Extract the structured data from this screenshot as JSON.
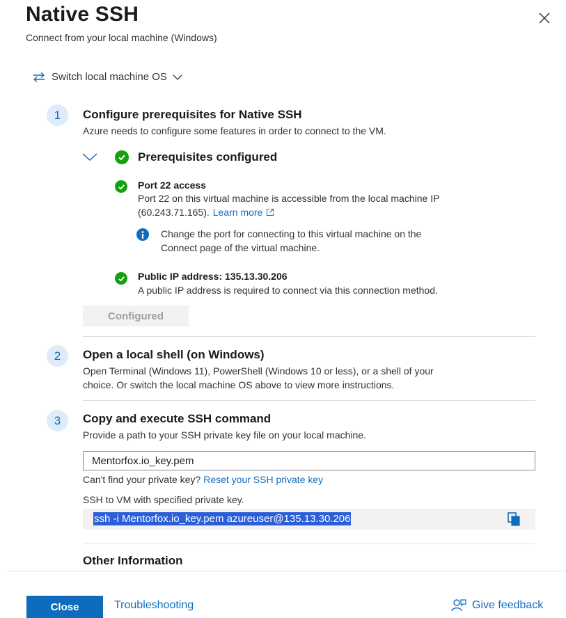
{
  "header": {
    "title": "Native SSH",
    "subtitle": "Connect from your local machine (Windows)"
  },
  "switch_os": {
    "label": "Switch local machine OS"
  },
  "step1": {
    "number": "1",
    "title": "Configure prerequisites for Native SSH",
    "description": "Azure needs to configure some features in order to connect to the VM.",
    "prereq_title": "Prerequisites configured",
    "port": {
      "title": "Port 22 access",
      "line1": "Port 22 on this virtual machine is accessible from the local machine IP",
      "line2": "(60.243.71.165).",
      "learn_more": "Learn more",
      "info_line1": "Change the port for connecting to this virtual machine on the",
      "info_line2": "Connect page of the virtual machine."
    },
    "public_ip": {
      "title": "Public IP address: 135.13.30.206",
      "description": "A public IP address is required to connect via this connection method."
    },
    "configured_label": "Configured"
  },
  "step2": {
    "number": "2",
    "title": "Open a local shell (on Windows)",
    "line1": "Open Terminal (Windows 11), PowerShell (Windows 10 or less), or a shell of your",
    "line2": "choice. Or switch the local machine OS above to view more instructions."
  },
  "step3": {
    "number": "3",
    "title": "Copy and execute SSH command",
    "description": "Provide a path to your SSH private key file on your local machine.",
    "key_value": "Mentorfox.io_key.pem",
    "cant_find": "Can't find your private key?",
    "reset_link": "Reset your SSH private key",
    "ssh_label": "SSH to VM with specified private key.",
    "command": "ssh -i Mentorfox.io_key.pem azureuser@135.13.30.206"
  },
  "other_info": {
    "title": "Other Information"
  },
  "footer": {
    "close": "Close",
    "troubleshooting": "Troubleshooting",
    "feedback": "Give feedback"
  },
  "colors": {
    "accent": "#0f6cbd",
    "success": "#13a10e",
    "step_bg": "#deecf9"
  }
}
